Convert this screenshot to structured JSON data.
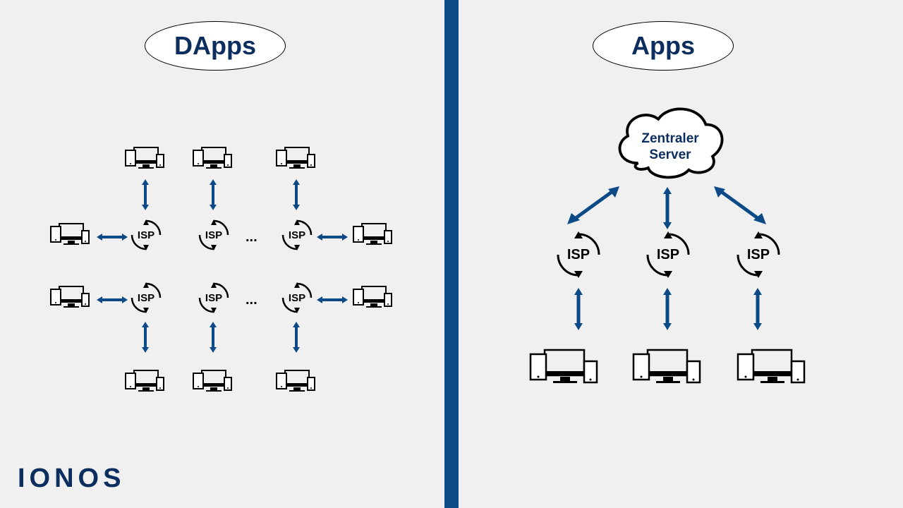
{
  "left": {
    "title": "DApps",
    "isp_label": "ISP",
    "ellipsis": "..."
  },
  "right": {
    "title": "Apps",
    "cloud_line1": "Zentraler",
    "cloud_line2": "Server",
    "isp_label": "ISP"
  },
  "brand": "IONOS"
}
